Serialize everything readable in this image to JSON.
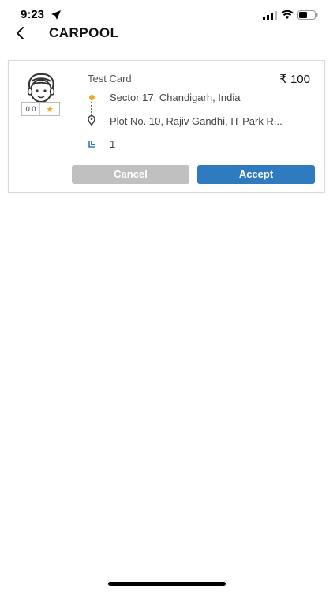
{
  "status_bar": {
    "time": "9:23",
    "icons": [
      "location-arrow-icon",
      "signal-icon",
      "wifi-icon",
      "battery-icon"
    ]
  },
  "header": {
    "title": "CARPOOL",
    "back_icon": "chevron-left-icon"
  },
  "card": {
    "name": "Test Card",
    "price": "100",
    "currency_symbol": "₹",
    "rating": "0.0",
    "pickup": "Sector 17, Chandigarh, India",
    "drop": "Plot No. 10, Rajiv Gandhi, IT Park R...",
    "seats": "1",
    "cancel_label": "Cancel",
    "accept_label": "Accept"
  },
  "colors": {
    "accent": "#2f7bc0",
    "cancel": "#c0c0c0",
    "pickup_dot": "#f5a623",
    "star": "#f5a623"
  }
}
